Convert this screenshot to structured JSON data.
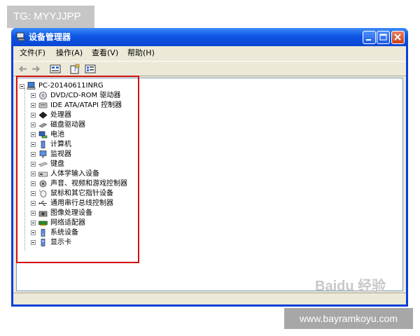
{
  "watermark_tag": "TG: MYYJJPP",
  "window": {
    "title": "设备管理器",
    "colors": {
      "titlebar": "#0d55e3",
      "close_button": "#c8401b",
      "frame": "#ece9d8",
      "highlight_box": "#d01010"
    }
  },
  "menu": [
    "文件(F)",
    "操作(A)",
    "查看(V)",
    "帮助(H)"
  ],
  "toolbar_icons": [
    "back-arrow-icon",
    "forward-arrow-icon",
    "device-view-icon",
    "properties-help-icon",
    "device-list-icon"
  ],
  "tree": {
    "root": "PC-20140611INRG",
    "items": [
      {
        "label": "DVD/CD-ROM 驱动器",
        "icon": "cd-drive-icon"
      },
      {
        "label": "IDE ATA/ATAPI 控制器",
        "icon": "ide-controller-icon"
      },
      {
        "label": "处理器",
        "icon": "processor-icon"
      },
      {
        "label": "磁盘驱动器",
        "icon": "disk-drive-icon"
      },
      {
        "label": "电池",
        "icon": "battery-icon"
      },
      {
        "label": "计算机",
        "icon": "computer-icon"
      },
      {
        "label": "监视器",
        "icon": "monitor-icon"
      },
      {
        "label": "键盘",
        "icon": "keyboard-icon"
      },
      {
        "label": "人体学输入设备",
        "icon": "hid-icon"
      },
      {
        "label": "声音、视频和游戏控制器",
        "icon": "sound-icon"
      },
      {
        "label": "鼠标和其它指针设备",
        "icon": "mouse-icon"
      },
      {
        "label": "通用串行总线控制器",
        "icon": "usb-icon"
      },
      {
        "label": "图像处理设备",
        "icon": "imaging-icon"
      },
      {
        "label": "网络适配器",
        "icon": "network-adapter-icon"
      },
      {
        "label": "系统设备",
        "icon": "system-device-icon"
      },
      {
        "label": "显示卡",
        "icon": "display-adapter-icon"
      }
    ]
  },
  "bottom_watermark": "Baidu 经验",
  "footer_watermark": "www.bayramkoyu.com"
}
